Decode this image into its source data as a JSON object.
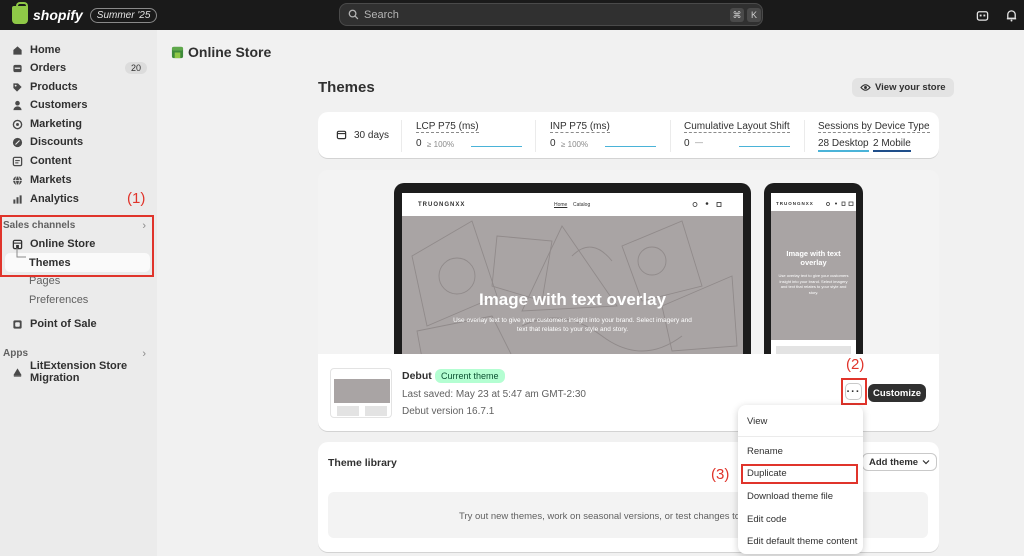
{
  "topbar": {
    "brand": "shopify",
    "edition": "Summer '25",
    "search_placeholder": "Search",
    "shortcut_key1": "⌘",
    "shortcut_key2": "K"
  },
  "sidebar": {
    "items": [
      {
        "label": "Home",
        "icon": "home-icon"
      },
      {
        "label": "Orders",
        "icon": "orders-icon",
        "count": "20"
      },
      {
        "label": "Products",
        "icon": "tag-icon"
      },
      {
        "label": "Customers",
        "icon": "person-icon"
      },
      {
        "label": "Marketing",
        "icon": "target-icon"
      },
      {
        "label": "Discounts",
        "icon": "discount-icon"
      },
      {
        "label": "Content",
        "icon": "content-icon"
      },
      {
        "label": "Markets",
        "icon": "globe-icon"
      },
      {
        "label": "Analytics",
        "icon": "bar-chart-icon"
      }
    ],
    "sales_channels_label": "Sales channels",
    "online_store_label": "Online Store",
    "themes_label": "Themes",
    "pages_label": "Pages",
    "preferences_label": "Preferences",
    "point_of_sale_label": "Point of Sale",
    "apps_label": "Apps",
    "app_item_label": "LitExtension Store Migration"
  },
  "annotations": {
    "step1": "(1)",
    "step2": "(2)",
    "step3": "(3)",
    "color": "#e0342b"
  },
  "header": {
    "section": "Online Store",
    "title": "Themes",
    "view_store": "View your store"
  },
  "metrics": {
    "period": "30 days",
    "lcp_label": "LCP P75 (ms)",
    "lcp_value": "0",
    "lcp_change": "≥ 100%",
    "inp_label": "INP P75 (ms)",
    "inp_value": "0",
    "inp_change": "≥ 100%",
    "cls_label": "Cumulative Layout Shift",
    "cls_value": "0",
    "cls_change": "—",
    "sessions_label": "Sessions by Device Type",
    "desktop_value": "28",
    "desktop_label": "Desktop",
    "mobile_value": "2",
    "mobile_label": "Mobile"
  },
  "preview": {
    "store_name": "TRUONGNXX",
    "nav_home": "Home",
    "nav_catalog": "Catalog",
    "hero_title": "Image with text overlay",
    "hero_text": "Use overlay text to give your customers insight into your brand. Select imagery and text that relates to your style and story.",
    "mobile_hero_title": "Image with text overlay",
    "mobile_hero_text": "Use overlay text to give your customers insight into your brand. Select imagery and text that relates to your style and story."
  },
  "current_theme": {
    "name": "Debut",
    "badge": "Current theme",
    "last_saved": "Last saved: May 23 at 5:47 am GMT-2:30",
    "version": "Debut version 16.7.1",
    "more_label": "···",
    "customize": "Customize"
  },
  "library": {
    "title": "Theme library",
    "add_theme": "Add theme",
    "empty_text": "Try out new themes, work on seasonal versions, or test changes to you"
  },
  "dropdown": {
    "items": [
      "View",
      "Rename",
      "Duplicate",
      "Download theme file",
      "Edit code",
      "Edit default theme content"
    ]
  }
}
